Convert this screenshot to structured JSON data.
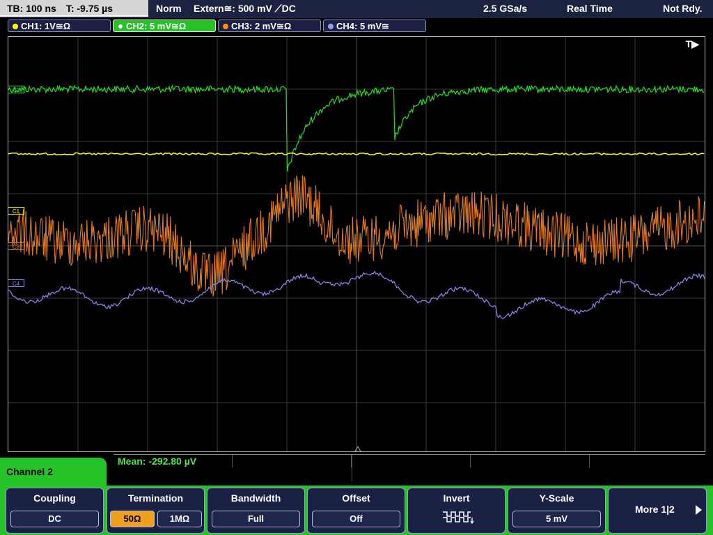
{
  "topbar": {
    "timebase": "TB: 100 ns",
    "trigger_time": "T: -9.75 µs",
    "mode": "Norm",
    "trigger_source": "Extern≅: 500 mV ⟋DC",
    "sample_rate": "2.5 GSa/s",
    "acquisition": "Real Time",
    "status": "Not Rdy."
  },
  "channels": [
    {
      "label": "CH1: 1V≅Ω",
      "color": "#ffff00"
    },
    {
      "label": "CH2: 5 mV≅Ω",
      "color": "#22dd22"
    },
    {
      "label": "CH3: 2 mV≅Ω",
      "color": "#ff8c1a"
    },
    {
      "label": "CH4: 5 mV≅",
      "color": "#9999ff"
    }
  ],
  "trigger_marker": "T▶",
  "markers": {
    "c2": "C2",
    "c1": "C1",
    "c3": "C3",
    "c4": "C4"
  },
  "measurement": {
    "mean": "Mean: -292.80 µV"
  },
  "channel_tab": "Channel 2",
  "softkeys": {
    "coupling": {
      "title": "Coupling",
      "value": "DC"
    },
    "termination": {
      "title": "Termination",
      "opt1": "50Ω",
      "opt2": "1MΩ"
    },
    "bandwidth": {
      "title": "Bandwidth",
      "value": "Full"
    },
    "offset": {
      "title": "Offset",
      "value": "Off"
    },
    "invert": {
      "title": "Invert",
      "icon": "inverted-pulse-icon"
    },
    "yscale": {
      "title": "Y-Scale",
      "value": "5 mV"
    },
    "more": {
      "label": "More 1|2"
    }
  }
}
